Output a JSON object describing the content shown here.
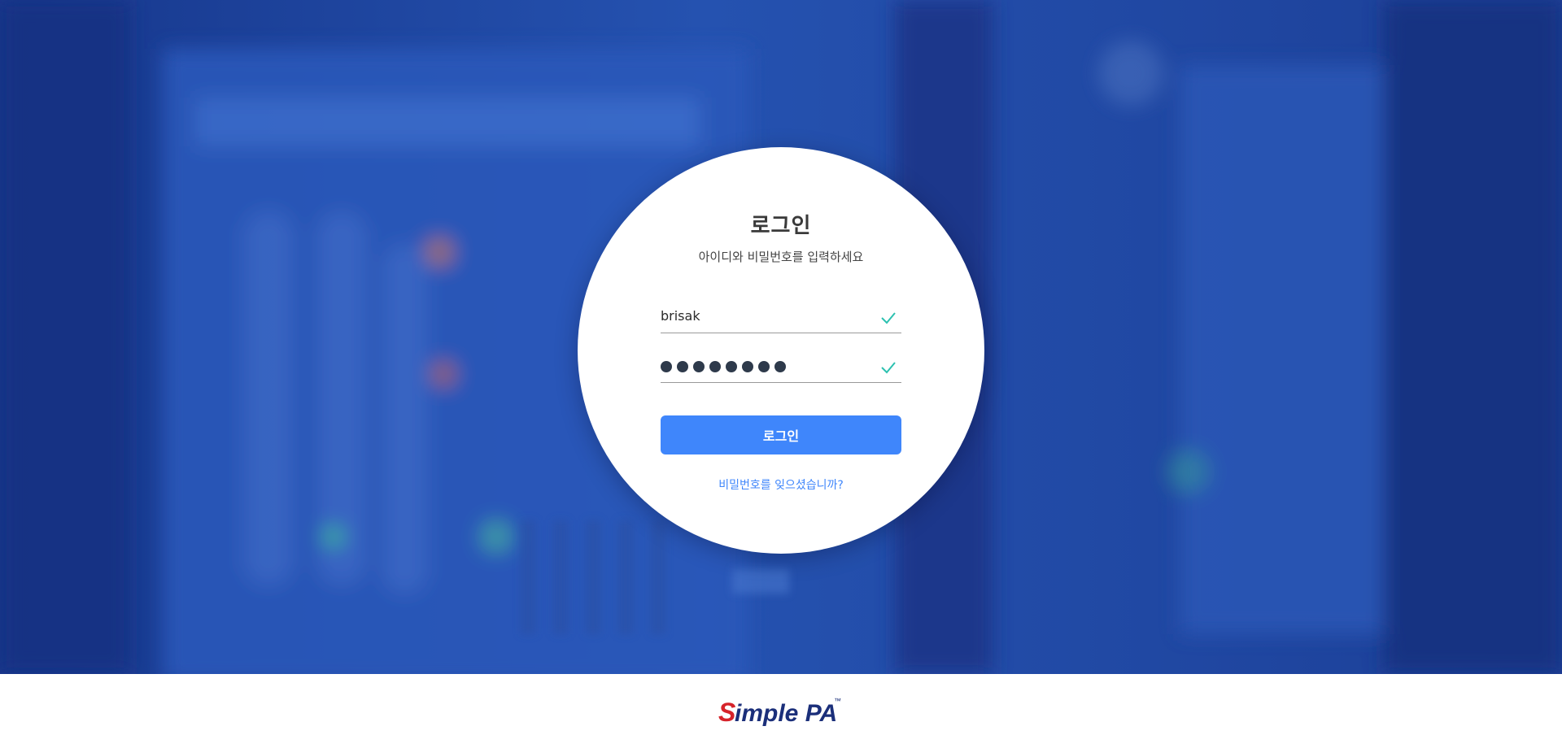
{
  "login": {
    "title": "로그인",
    "subtitle": "아이디와 비밀번호를 입력하세요",
    "username_value": "brisak",
    "password_masked_length": 8,
    "button_label": "로그인",
    "forgot_link": "비밀번호를 잊으셨습니까?"
  },
  "footer": {
    "logo_text": "SimplePA",
    "logo_trademark": "™"
  },
  "icons": {
    "field_valid": "check-icon",
    "background": "server-rack-photo"
  },
  "colors": {
    "background_tint": "#1d47a0",
    "primary_button": "#3f86fb",
    "check": "#2cc1b0",
    "logo_red": "#d6232a",
    "logo_navy": "#1b2f7a"
  }
}
